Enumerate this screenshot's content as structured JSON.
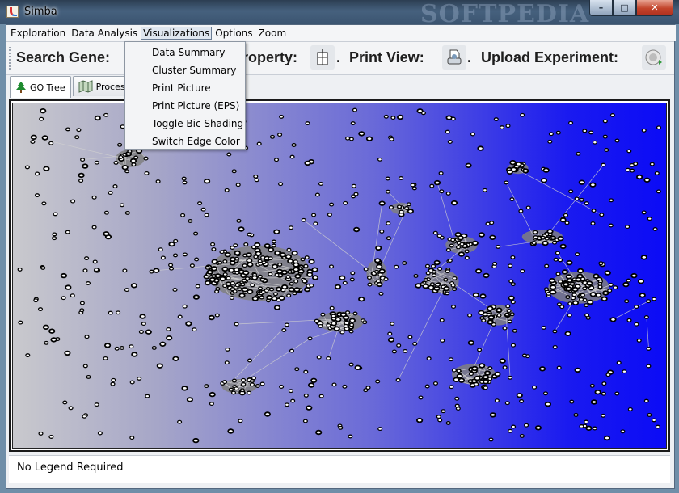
{
  "window": {
    "title": "Simba",
    "watermark": "SOFTPEDIA",
    "controls": {
      "minimize": "–",
      "maximize": "□",
      "close": "✕"
    }
  },
  "menubar": {
    "items": [
      {
        "label": "Exploration"
      },
      {
        "label": "Data Analysis"
      },
      {
        "label": "Visualizations",
        "active": true
      },
      {
        "label": "Options"
      },
      {
        "label": "Zoom"
      }
    ]
  },
  "toolbar": {
    "search_gene_label": "Search Gene:",
    "property_label": "roperty:",
    "property_dot": ".",
    "print_view_label": "Print View:",
    "print_view_dot": ".",
    "upload_experiment_label": "Upload Experiment:"
  },
  "tabs": [
    {
      "label": "GO Tree",
      "icon": "tree-icon"
    },
    {
      "label": "Process I",
      "icon": "map-icon"
    }
  ],
  "visualizations_menu": {
    "items": [
      "Data Summary",
      "Cluster Summary",
      "Print Picture",
      "Print Picture (EPS)",
      "Toggle Bic Shading",
      "Switch Edge Color"
    ]
  },
  "legend": {
    "text": "No Legend Required"
  },
  "colors": {
    "graph_gradient_start": "#c9c9cd",
    "graph_gradient_end": "#0b0bf6",
    "node_fill": "#ffffff",
    "node_stroke": "#000000",
    "edge": "#d0d0d0",
    "cluster_shade": "#808080"
  }
}
